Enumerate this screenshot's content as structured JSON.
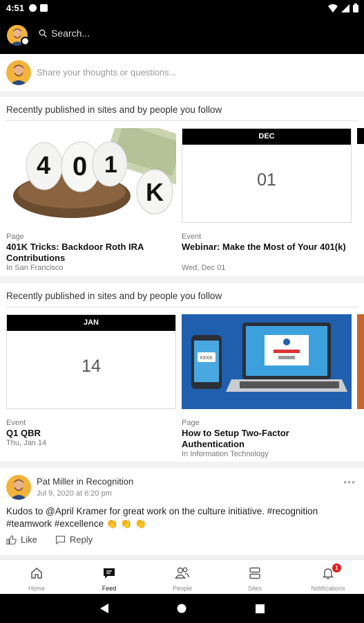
{
  "status_bar": {
    "time": "4:51"
  },
  "header": {
    "search_placeholder": "Search..."
  },
  "composer": {
    "placeholder": "Share your thoughts or questions..."
  },
  "sections": [
    {
      "title": "Recently published in sites and by people you follow",
      "cards": [
        {
          "kind": "Page",
          "title": "401K Tricks: Backdoor Roth IRA Contributions",
          "sub": "In San Francisco",
          "image_text": "401K"
        },
        {
          "kind": "Event",
          "title": "Webinar: Make the Most of Your 401(k)",
          "sub": "Wed, Dec 01",
          "month": "DEC",
          "day": "01"
        }
      ]
    },
    {
      "title": "Recently published in sites and by people you follow",
      "cards": [
        {
          "kind": "Event",
          "title": "Q1 QBR",
          "sub": "Thu, Jan 14",
          "month": "JAN",
          "day": "14"
        },
        {
          "kind": "Page",
          "title": "How to Setup Two-Factor Authentication",
          "sub": "In Information Technology",
          "image_text": "XXXX"
        }
      ]
    }
  ],
  "post": {
    "author": "Pat Miller in Recognition",
    "date": "Jul 9, 2020 at 6:20 pm",
    "body": "Kudos to @April Kramer for great work on the culture initiative. #recognition #teamwork  #excellence 👏 👏 👏",
    "like_label": "Like",
    "reply_label": "Reply"
  },
  "nav": {
    "items": [
      {
        "label": "Home",
        "icon": "home-icon"
      },
      {
        "label": "Feed",
        "icon": "feed-icon"
      },
      {
        "label": "People",
        "icon": "people-icon"
      },
      {
        "label": "Sites",
        "icon": "sites-icon"
      },
      {
        "label": "Notifications",
        "icon": "bell-icon",
        "badge": "1"
      }
    ],
    "active": "Feed"
  },
  "colors": {
    "accent_red": "#e02020",
    "bar_black": "#000000",
    "laptop_blue": "#1f5fae"
  }
}
